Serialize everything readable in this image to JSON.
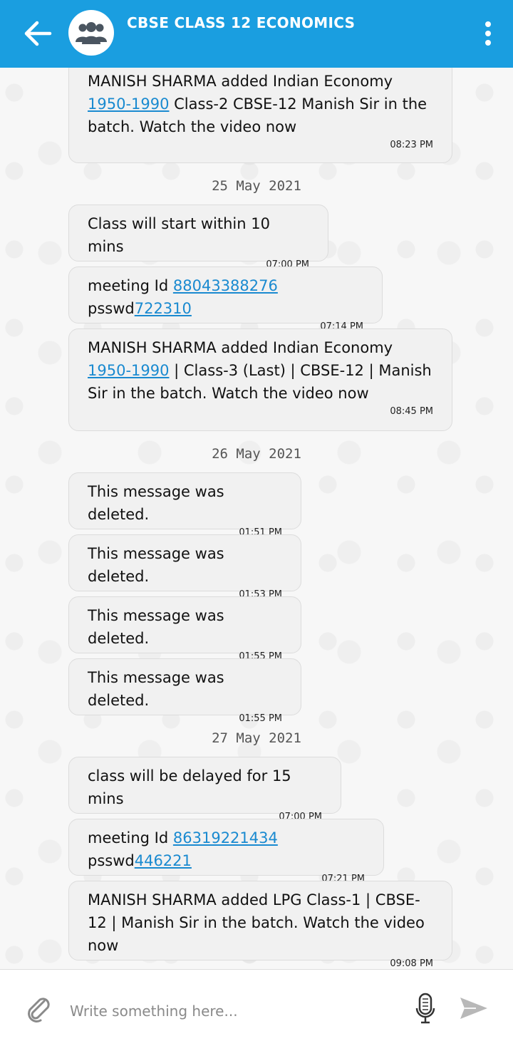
{
  "header": {
    "title": "CBSE CLASS 12 ECONOMICS",
    "back_icon": "arrow-left-icon",
    "avatar_icon": "group-icon",
    "menu_icon": "more-vertical-icon"
  },
  "messages": [
    {
      "type": "message",
      "prefix": "MANISH SHARMA added Indian Economy ",
      "link": "1950-1990",
      "suffix": " Class-2 CBSE-12 Manish Sir in the batch. Watch the video now",
      "time": "08:23 PM"
    },
    {
      "type": "date",
      "text": "25 May 2021"
    },
    {
      "type": "message",
      "text": "Class will start within 10 mins",
      "time": "07:00 PM"
    },
    {
      "type": "message",
      "prefix": "meeting Id ",
      "link": "88043388276",
      "middle": " psswd",
      "link2": "722310",
      "time": "07:14 PM"
    },
    {
      "type": "message",
      "prefix": "MANISH SHARMA added Indian Economy ",
      "link": "1950-1990",
      "suffix": " | Class-3 (Last) | CBSE-12 | Manish Sir in the batch. Watch the video now",
      "time": "08:45 PM"
    },
    {
      "type": "date",
      "text": "26 May 2021"
    },
    {
      "type": "message",
      "text": "This message was deleted.",
      "time": "01:51 PM"
    },
    {
      "type": "message",
      "text": "This message was deleted.",
      "time": "01:53 PM"
    },
    {
      "type": "message",
      "text": "This message was deleted.",
      "time": "01:55 PM"
    },
    {
      "type": "message",
      "text": "This message was deleted.",
      "time": "01:55 PM"
    },
    {
      "type": "date",
      "text": "27 May 2021"
    },
    {
      "type": "message",
      "text": "class will be delayed for 15 mins",
      "time": "07:00 PM"
    },
    {
      "type": "message",
      "prefix": "meeting Id ",
      "link": "86319221434",
      "middle": " psswd",
      "link2": "446221",
      "time": "07:21 PM"
    },
    {
      "type": "message",
      "text": "MANISH SHARMA added LPG Class-1 | CBSE-12 | Manish Sir in the batch. Watch the video now",
      "time": "09:08 PM"
    }
  ],
  "composer": {
    "placeholder": "Write something here...",
    "attach_icon": "paperclip-icon",
    "mic_icon": "microphone-icon",
    "send_icon": "send-icon"
  },
  "colors": {
    "header": "#1a9ee0",
    "link": "#1a8ad0",
    "bubble": "#f1f1f1"
  }
}
